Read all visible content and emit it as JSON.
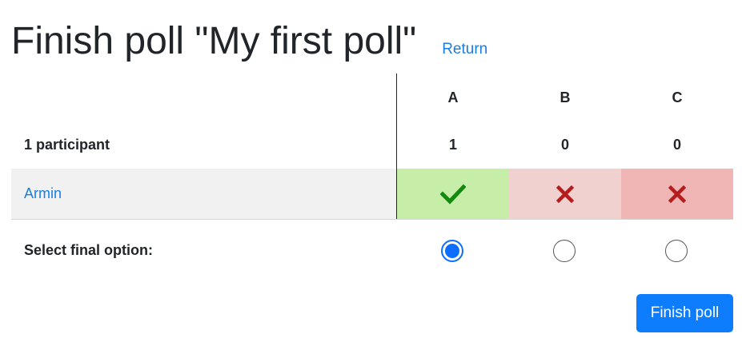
{
  "header": {
    "title": "Finish poll \"My first poll\"",
    "return_label": "Return"
  },
  "table": {
    "options": [
      "A",
      "B",
      "C"
    ],
    "participant_count_label": "1 participant",
    "option_counts": [
      "1",
      "0",
      "0"
    ],
    "participants": [
      {
        "name": "Armin",
        "votes": [
          "yes",
          "no",
          "no"
        ]
      }
    ],
    "select_label": "Select final option:",
    "selected_option": "A"
  },
  "actions": {
    "finish_label": "Finish poll"
  },
  "colors": {
    "accent": "#0d7dfd",
    "link": "#1a7ee0",
    "yes_bg": "#c7eea8",
    "no_bg_light": "#f1d0d0",
    "no_bg_dark": "#f0b6b6",
    "check_color": "#118a0e",
    "cross_color": "#b51c1c"
  },
  "icons": {
    "vote_yes": "check-icon",
    "vote_no": "cross-icon"
  }
}
